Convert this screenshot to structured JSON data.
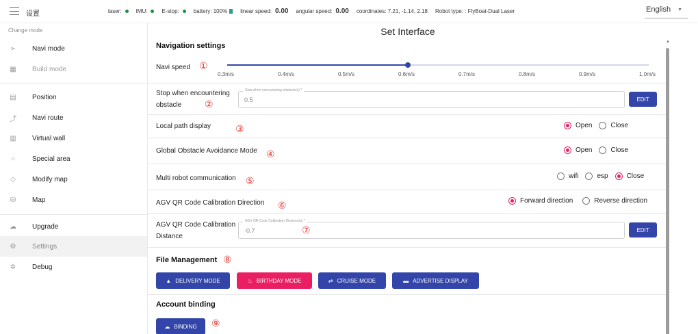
{
  "app": {
    "title": "设置"
  },
  "status": {
    "laser_label": "laser:",
    "imu_label": "IMU:",
    "estop_label": "E-stop:",
    "battery_label": "battery:",
    "battery_value": "100%",
    "linear_label": "linear speed:",
    "linear_value": "0.00",
    "angular_label": "angular speed:",
    "angular_value": "0.00",
    "coord_label": "coordinates:",
    "coord_value": "7.21, -1.14, 2.18",
    "robot_type_label": "Robot type: :",
    "robot_type_value": "FlyBoat-Dual Laser",
    "ok_color": "#1f8f3a"
  },
  "language": {
    "selected": "English"
  },
  "sidebar": {
    "heading": "Change mode",
    "items": [
      {
        "label": "Navi mode",
        "icon": "send-icon"
      },
      {
        "label": "Build mode",
        "icon": "build-icon"
      },
      {
        "label": "Position",
        "icon": "position-icon"
      },
      {
        "label": "Navi route",
        "icon": "route-icon"
      },
      {
        "label": "Virtual wall",
        "icon": "wall-icon"
      },
      {
        "label": "Special area",
        "icon": "area-icon"
      },
      {
        "label": "Modify map",
        "icon": "modify-map-icon"
      },
      {
        "label": "Map",
        "icon": "map-icon"
      },
      {
        "label": "Upgrade",
        "icon": "cloud-upgrade-icon"
      },
      {
        "label": "Settings",
        "icon": "gear-icon"
      },
      {
        "label": "Debug",
        "icon": "bug-icon"
      }
    ]
  },
  "main": {
    "title": "Set Interface",
    "nav_section": "Navigation settings",
    "navi_speed": {
      "label": "Navi speed",
      "ticks": [
        "0.3m/s",
        "0.4m/s",
        "0.5m/s",
        "0.6m/s",
        "0.7m/s",
        "0.8m/s",
        "0.9m/s",
        "1.0m/s"
      ],
      "value": "0.6m/s",
      "fraction": 0.4286
    },
    "stop_obstacle": {
      "label_line1": "Stop when encountering",
      "label_line2": "obstacle",
      "field_label": "Stop when encountering obstacle(s) *",
      "value": "0.5",
      "button": "EDIT"
    },
    "local_path": {
      "label": "Local path display",
      "options": [
        "Open",
        "Close"
      ]
    },
    "global_avoid": {
      "label": "Global Obstacle Avoidance Mode",
      "options": [
        "Open",
        "Close"
      ]
    },
    "multi_robot": {
      "label": "Multi robot communication",
      "options": [
        "wifi",
        "esp",
        "Close"
      ]
    },
    "qr_direction": {
      "label": "AGV QR Code Calibration Direction",
      "options": [
        "Forward direction",
        "Reverse direction"
      ]
    },
    "qr_distance": {
      "label_line1": "AGV QR Code Calibration",
      "label_line2": "Distance",
      "field_label": "AGV QR Code Calibration Distance(s) *",
      "value": "-0.7",
      "button": "EDIT"
    },
    "file_section": "File Management",
    "file_buttons": [
      "DELIVERY MODE",
      "BIRTHDAY MODE",
      "CRUISE MODE",
      "ADVERTISE DISPLAY"
    ],
    "account_section": "Account binding",
    "binding_button": "BINDING",
    "markers": [
      "①",
      "②",
      "③",
      "④",
      "⑤",
      "⑥",
      "⑦",
      "⑧",
      "⑨"
    ],
    "accent_blue": "#3345a8",
    "accent_pink": "#e91e63"
  }
}
